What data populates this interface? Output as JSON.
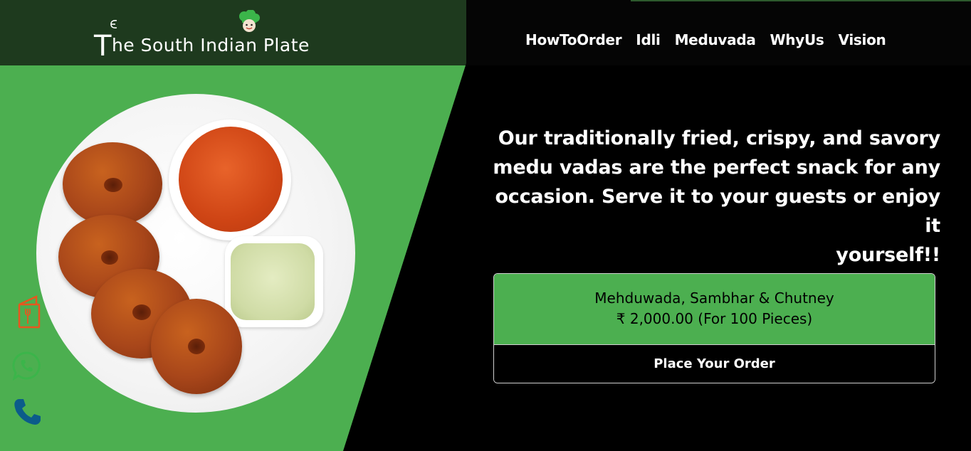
{
  "header": {
    "brand": "The South Indian Plate",
    "brand_initial": "T",
    "brand_rest": "he South Indian Plate"
  },
  "nav": {
    "items": [
      {
        "label": "HowToOrder"
      },
      {
        "label": "Idli"
      },
      {
        "label": "Meduvada"
      },
      {
        "label": "WhyUs"
      },
      {
        "label": "Vision"
      }
    ]
  },
  "hero": {
    "line1": "Our traditionally fried, crispy, and savory",
    "line2": "medu vadas are the perfect snack for any",
    "line3": "occasion. Serve it to your guests or enjoy it",
    "line4": "yourself!!"
  },
  "product": {
    "name": "Mehduwada, Sambhar & Chutney",
    "price": "₹ 2,000.00 (For 100 Pieces)",
    "order_button": "Place Your Order"
  },
  "side_icons": [
    "menu-icon",
    "whatsapp-icon",
    "phone-icon"
  ],
  "colors": {
    "green": "#4caf50",
    "header_dark_green": "#1e3a1e",
    "background": "#000000",
    "menu_icon": "#e8561e",
    "whatsapp_icon": "#3bb54a",
    "phone_icon": "#0b5c8a"
  }
}
